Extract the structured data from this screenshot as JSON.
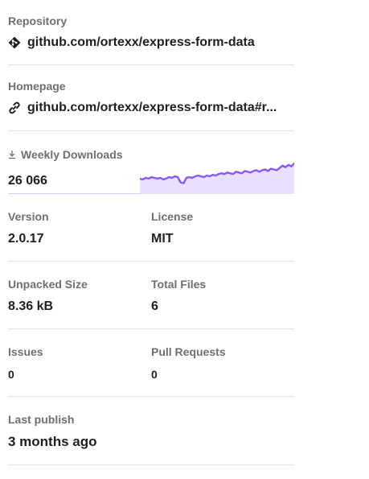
{
  "repository": {
    "label": "Repository",
    "icon": "git-icon",
    "link": "github.com/ortexx/express-form-data"
  },
  "homepage": {
    "label": "Homepage",
    "icon": "link-icon",
    "link": "github.com/ortexx/express-form-data#r..."
  },
  "downloads": {
    "label": "Weekly Downloads",
    "icon": "download-icon",
    "value": "26 066",
    "accent": "#8956ff",
    "fill": "#e9e0ff"
  },
  "version": {
    "label": "Version",
    "value": "2.0.17"
  },
  "license": {
    "label": "License",
    "value": "MIT"
  },
  "unpacked_size": {
    "label": "Unpacked Size",
    "value": "8.36 kB"
  },
  "total_files": {
    "label": "Total Files",
    "value": "6"
  },
  "issues": {
    "label": "Issues",
    "value": "0"
  },
  "pull_requests": {
    "label": "Pull Requests",
    "value": "0"
  },
  "last_publish": {
    "label": "Last publish",
    "value": "3 months ago"
  },
  "chart_data": {
    "type": "area",
    "values": [
      18,
      17,
      19,
      18,
      20,
      19,
      18,
      19,
      17,
      18,
      20,
      19,
      21,
      20,
      13,
      12,
      19,
      20,
      19,
      21,
      22,
      21,
      20,
      22,
      21,
      23,
      22,
      24,
      25,
      24,
      26,
      25,
      24,
      27,
      26,
      25,
      28,
      27,
      26,
      28,
      29,
      27,
      29,
      30,
      28,
      31,
      30,
      29,
      32,
      35,
      33,
      36,
      34,
      38
    ],
    "ylim": [
      0,
      40
    ]
  }
}
